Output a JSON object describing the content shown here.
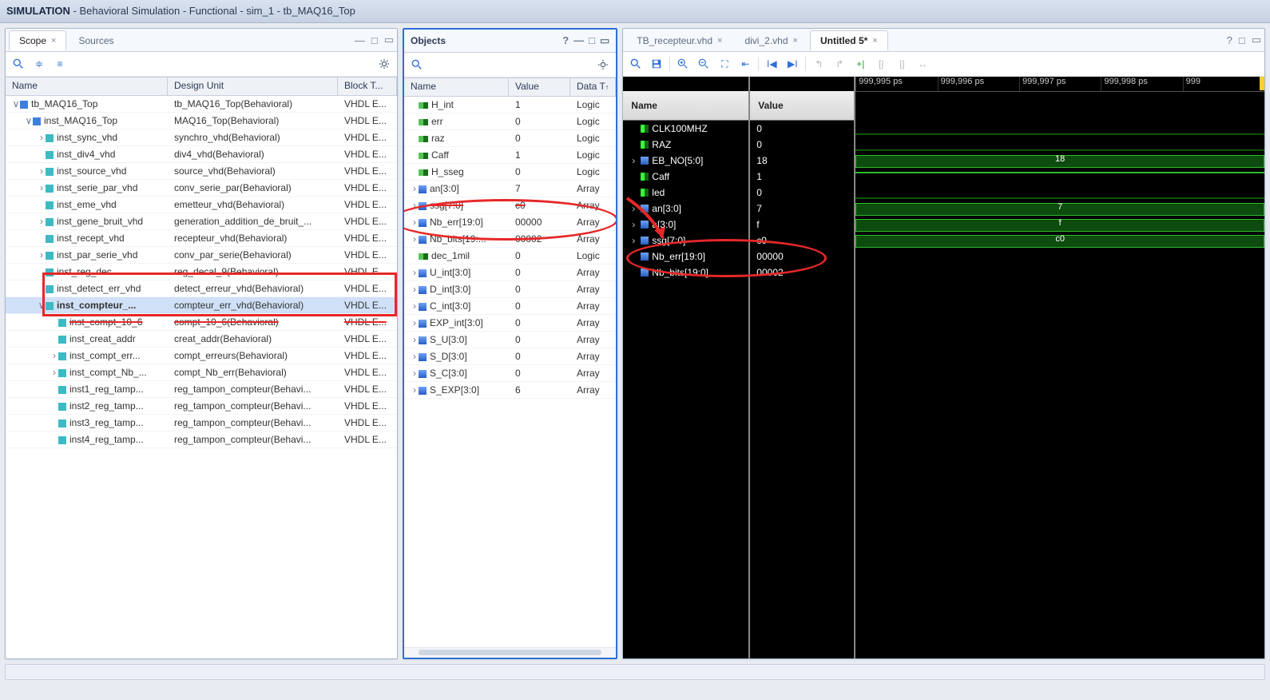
{
  "title": {
    "prefix": "SIMULATION",
    "rest": " - Behavioral Simulation - Functional - sim_1 - tb_MAQ16_Top"
  },
  "scope": {
    "tabs": [
      {
        "label": "Scope",
        "active": true
      },
      {
        "label": "Sources",
        "active": false
      }
    ],
    "headers": [
      "Name",
      "Design Unit",
      "Block T..."
    ],
    "rows": [
      {
        "d": 0,
        "exp": "v",
        "ic": "blue",
        "name": "tb_MAQ16_Top",
        "du": "tb_MAQ16_Top(Behavioral)",
        "bt": "VHDL E..."
      },
      {
        "d": 1,
        "exp": "v",
        "ic": "blue",
        "name": "inst_MAQ16_Top",
        "du": "MAQ16_Top(Behavioral)",
        "bt": "VHDL E..."
      },
      {
        "d": 2,
        "exp": ">",
        "ic": "teal",
        "name": "inst_sync_vhd",
        "du": "synchro_vhd(Behavioral)",
        "bt": "VHDL E..."
      },
      {
        "d": 2,
        "exp": "",
        "ic": "teal",
        "name": "inst_div4_vhd",
        "du": "div4_vhd(Behavioral)",
        "bt": "VHDL E..."
      },
      {
        "d": 2,
        "exp": ">",
        "ic": "teal",
        "name": "inst_source_vhd",
        "du": "source_vhd(Behavioral)",
        "bt": "VHDL E..."
      },
      {
        "d": 2,
        "exp": ">",
        "ic": "teal",
        "name": "inst_serie_par_vhd",
        "du": "conv_serie_par(Behavioral)",
        "bt": "VHDL E..."
      },
      {
        "d": 2,
        "exp": "",
        "ic": "teal",
        "name": "inst_eme_vhd",
        "du": "emetteur_vhd(Behavioral)",
        "bt": "VHDL E..."
      },
      {
        "d": 2,
        "exp": ">",
        "ic": "teal",
        "name": "inst_gene_bruit_vhd",
        "du": "generation_addition_de_bruit_...",
        "bt": "VHDL E..."
      },
      {
        "d": 2,
        "exp": "",
        "ic": "teal",
        "name": "inst_recept_vhd",
        "du": "recepteur_vhd(Behavioral)",
        "bt": "VHDL E..."
      },
      {
        "d": 2,
        "exp": ">",
        "ic": "teal",
        "name": "inst_par_serie_vhd",
        "du": "conv_par_serie(Behavioral)",
        "bt": "VHDL E..."
      },
      {
        "d": 2,
        "exp": "",
        "ic": "teal",
        "name": "inst_reg_dec",
        "du": "reg_decal_9(Behavioral)",
        "bt": "VHDL E..."
      },
      {
        "d": 2,
        "exp": "",
        "ic": "teal",
        "name": "inst_detect_err_vhd",
        "du": "detect_erreur_vhd(Behavioral)",
        "bt": "VHDL E...",
        "red": true
      },
      {
        "d": 2,
        "exp": "v",
        "ic": "teal",
        "name": "inst_compteur_...",
        "du": "compteur_err_vhd(Behavioral)",
        "bt": "VHDL E...",
        "sel": true,
        "bold": true,
        "red": true
      },
      {
        "d": 3,
        "exp": "",
        "ic": "teal",
        "name": "inst_compt_10_6",
        "du": "compt_10_6(Behavioral)",
        "bt": "VHDL E...",
        "strike": true
      },
      {
        "d": 3,
        "exp": "",
        "ic": "teal",
        "name": "inst_creat_addr",
        "du": "creat_addr(Behavioral)",
        "bt": "VHDL E..."
      },
      {
        "d": 3,
        "exp": ">",
        "ic": "teal",
        "name": "inst_compt_err...",
        "du": "compt_erreurs(Behavioral)",
        "bt": "VHDL E..."
      },
      {
        "d": 3,
        "exp": ">",
        "ic": "teal",
        "name": "inst_compt_Nb_...",
        "du": "compt_Nb_err(Behavioral)",
        "bt": "VHDL E..."
      },
      {
        "d": 3,
        "exp": "",
        "ic": "teal",
        "name": "inst1_reg_tamp...",
        "du": "reg_tampon_compteur(Behavi...",
        "bt": "VHDL E..."
      },
      {
        "d": 3,
        "exp": "",
        "ic": "teal",
        "name": "inst2_reg_tamp...",
        "du": "reg_tampon_compteur(Behavi...",
        "bt": "VHDL E..."
      },
      {
        "d": 3,
        "exp": "",
        "ic": "teal",
        "name": "inst3_reg_tamp...",
        "du": "reg_tampon_compteur(Behavi...",
        "bt": "VHDL E..."
      },
      {
        "d": 3,
        "exp": "",
        "ic": "teal",
        "name": "inst4_reg_tamp...",
        "du": "reg_tampon_compteur(Behavi...",
        "bt": "VHDL E..."
      }
    ]
  },
  "objects": {
    "title": "Objects",
    "headers": [
      "Name",
      "Value",
      "Data T"
    ],
    "rows": [
      {
        "exp": "",
        "ic": "sig",
        "name": "H_int",
        "val": "1",
        "dt": "Logic"
      },
      {
        "exp": "",
        "ic": "sig",
        "name": "err",
        "val": "0",
        "dt": "Logic"
      },
      {
        "exp": "",
        "ic": "sig",
        "name": "raz",
        "val": "0",
        "dt": "Logic"
      },
      {
        "exp": "",
        "ic": "sig",
        "name": "Caff",
        "val": "1",
        "dt": "Logic"
      },
      {
        "exp": "",
        "ic": "sig",
        "name": "H_sseg",
        "val": "0",
        "dt": "Logic"
      },
      {
        "exp": ">",
        "ic": "bus",
        "name": "an[3:0]",
        "val": "7",
        "dt": "Array"
      },
      {
        "exp": ">",
        "ic": "bus",
        "name": "ssg[7:0]",
        "val": "c0",
        "dt": "Array",
        "strike": true
      },
      {
        "exp": ">",
        "ic": "bus",
        "name": "Nb_err[19:0]",
        "val": "00000",
        "dt": "Array"
      },
      {
        "exp": ">",
        "ic": "bus",
        "name": "Nb_bits[19:...",
        "val": "00002",
        "dt": "Array"
      },
      {
        "exp": "",
        "ic": "sig",
        "name": "dec_1mil",
        "val": "0",
        "dt": "Logic"
      },
      {
        "exp": ">",
        "ic": "bus",
        "name": "U_int[3:0]",
        "val": "0",
        "dt": "Array"
      },
      {
        "exp": ">",
        "ic": "bus",
        "name": "D_int[3:0]",
        "val": "0",
        "dt": "Array"
      },
      {
        "exp": ">",
        "ic": "bus",
        "name": "C_int[3:0]",
        "val": "0",
        "dt": "Array"
      },
      {
        "exp": ">",
        "ic": "bus",
        "name": "EXP_int[3:0]",
        "val": "0",
        "dt": "Array"
      },
      {
        "exp": ">",
        "ic": "bus",
        "name": "S_U[3:0]",
        "val": "0",
        "dt": "Array"
      },
      {
        "exp": ">",
        "ic": "bus",
        "name": "S_D[3:0]",
        "val": "0",
        "dt": "Array"
      },
      {
        "exp": ">",
        "ic": "bus",
        "name": "S_C[3:0]",
        "val": "0",
        "dt": "Array"
      },
      {
        "exp": ">",
        "ic": "bus",
        "name": "S_EXP[3:0]",
        "val": "6",
        "dt": "Array"
      }
    ]
  },
  "wave": {
    "tabs": [
      {
        "label": "TB_recepteur.vhd",
        "active": false
      },
      {
        "label": "divi_2.vhd",
        "active": false
      },
      {
        "label": "Untitled 5*",
        "active": true
      }
    ],
    "nameHeader": "Name",
    "valueHeader": "Value",
    "ticks": [
      "999,995 ps",
      "999,996 ps",
      "999,997 ps",
      "999,998 ps",
      "999"
    ],
    "signals": [
      {
        "exp": "",
        "ic": "sig",
        "name": "CLK100MHZ",
        "val": "0",
        "style": "low"
      },
      {
        "exp": "",
        "ic": "sig",
        "name": "RAZ",
        "val": "0",
        "style": "low"
      },
      {
        "exp": ">",
        "ic": "bus",
        "name": "EB_NO[5:0]",
        "val": "18",
        "style": "bus",
        "disp": "18"
      },
      {
        "exp": "",
        "ic": "sig",
        "name": "Caff",
        "val": "1",
        "style": "high"
      },
      {
        "exp": "",
        "ic": "sig",
        "name": "led",
        "val": "0",
        "style": "low"
      },
      {
        "exp": ">",
        "ic": "bus",
        "name": "an[3:0]",
        "val": "7",
        "style": "bus",
        "disp": "7"
      },
      {
        "exp": ">",
        "ic": "bus",
        "name": "a[3:0]",
        "val": "f",
        "style": "bus",
        "disp": "f"
      },
      {
        "exp": ">",
        "ic": "bus",
        "name": "ssg[7:0]",
        "val": "c0",
        "style": "bus",
        "disp": "c0"
      },
      {
        "exp": "",
        "ic": "bus",
        "name": "Nb_err[19:0]",
        "val": "00000",
        "style": "none"
      },
      {
        "exp": "",
        "ic": "bus",
        "name": "Nb_bits[19:0]",
        "val": "00002",
        "style": "none"
      }
    ]
  }
}
